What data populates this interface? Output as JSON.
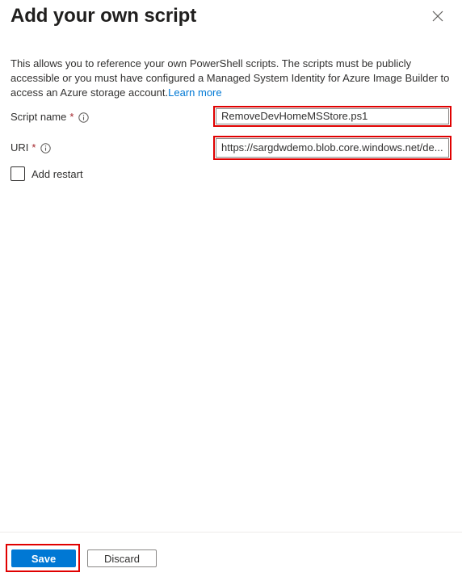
{
  "panel": {
    "title": "Add your own script",
    "close_icon": "close-icon",
    "description": "This allows you to reference your own PowerShell scripts. The scripts must be publicly accessible or you must have configured a Managed System Identity for Azure Image Builder to access an Azure storage account.",
    "learn_more": "Learn more"
  },
  "fields": {
    "script_name": {
      "label": "Script name",
      "required_marker": "*",
      "value": "RemoveDevHomeMSStore.ps1"
    },
    "uri": {
      "label": "URI",
      "required_marker": "*",
      "value": "https://sargdwdemo.blob.core.windows.net/de..."
    },
    "add_restart": {
      "label": "Add restart",
      "checked": false
    }
  },
  "footer": {
    "save_label": "Save",
    "discard_label": "Discard"
  },
  "colors": {
    "accent": "#0078d4",
    "highlight": "#e00000",
    "required": "#a4262c"
  }
}
